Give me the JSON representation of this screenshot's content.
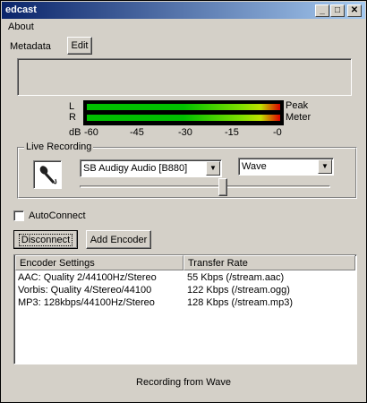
{
  "window": {
    "title": "edcast",
    "min_glyph": "_",
    "max_glyph": "□",
    "close_glyph": "✕"
  },
  "menu": {
    "about": "About"
  },
  "metadata": {
    "label": "Metadata",
    "edit_label": "Edit",
    "text": ""
  },
  "meter": {
    "left_label": "L",
    "right_label": "R",
    "peak_label": "Peak",
    "meter_label": "Meter",
    "scale": [
      "dB",
      "-60",
      "-45",
      "-30",
      "-15",
      "-0"
    ],
    "left_level": 1.0,
    "right_level": 1.0
  },
  "live_recording": {
    "label": "Live Recording",
    "device": "SB Audigy Audio [B880]",
    "source": "Wave",
    "slider_level": 0.57
  },
  "autoconnect": {
    "label": "AutoConnect",
    "checked": false
  },
  "buttons": {
    "disconnect": "Disconnect",
    "add_encoder": "Add Encoder"
  },
  "encoders": {
    "headers": [
      "Encoder Settings",
      "Transfer Rate"
    ],
    "rows": [
      {
        "settings": "AAC: Quality 2/44100Hz/Stereo",
        "rate": "55 Kbps (/stream.aac)"
      },
      {
        "settings": "Vorbis: Quality 4/Stereo/44100",
        "rate": "122 Kbps (/stream.ogg)"
      },
      {
        "settings": "MP3: 128kbps/44100Hz/Stereo",
        "rate": "128 Kbps (/stream.mp3)"
      }
    ]
  },
  "status": "Recording from Wave",
  "colors": {
    "titlebar": "#0a246a",
    "face": "#d4d0c8",
    "meter_green": "#00c000",
    "meter_red": "#e00000"
  }
}
